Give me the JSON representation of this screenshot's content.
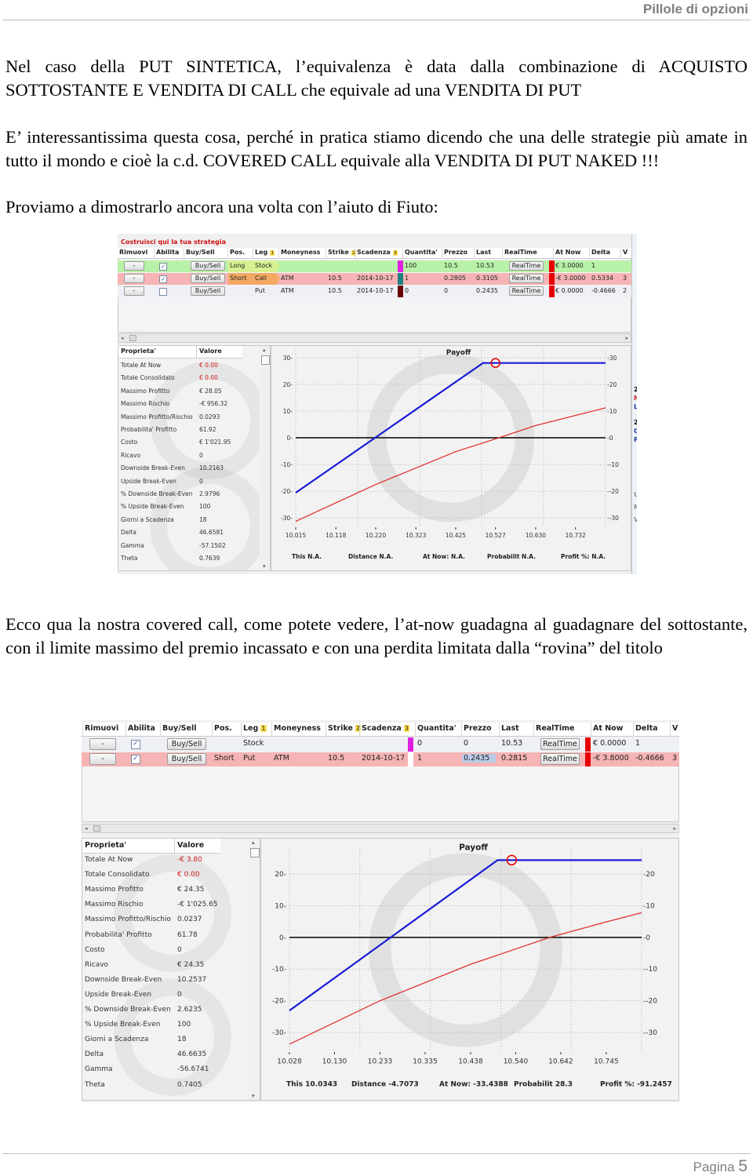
{
  "header": {
    "title": "Pillole di opzioni"
  },
  "paragraphs": [
    "Nel caso della PUT SINTETICA, l’equivalenza è data dalla combinazione di ACQUISTO SOTTOSTANTE E VENDITA DI CALL che equivale ad una VENDITA DI PUT",
    "E’ interessantissima questa cosa, perché in pratica stiamo dicendo che una delle strategie più amate in tutto il mondo e cioè la c.d. COVERED CALL equivale alla VENDITA DI PUT NAKED !!!",
    "Proviamo a dimostrarlo ancora una volta con l’aiuto di Fiuto:",
    "Ecco qua la nostra covered call, come potete vedere, l’at-now guadagna al guadagnare del sottostante, con il limite massimo del premio incassato e con una perdita limitata dalla “rovina” del titolo"
  ],
  "footer": {
    "label": "Pagina",
    "page": "5"
  },
  "colors": {
    "blue_line": "#1a1ad8",
    "red_line": "#e03030",
    "row_long": "#b8f2a8",
    "row_short": "#f6b4b4",
    "row_off": "#eef0f6",
    "status_red": "#e80000",
    "negative": "#d02020"
  },
  "screenshots": [
    {
      "builder_title": "Costruisci qui la tua strategia",
      "columns": [
        "Rimuovi",
        "Abilita",
        "Buy/Sell",
        "Pos.",
        "Leg",
        "Moneyness",
        "Strike",
        "Scadenza",
        "",
        "Quantita'",
        "Prezzo",
        "Last",
        "RealTime",
        "",
        "At Now",
        "Delta",
        "V"
      ],
      "sort_badges": {
        "Leg": "1",
        "Strike": "2",
        "Scadenza": "3"
      },
      "remove_label": "-",
      "buysell_label": "Buy/Sell",
      "realtime_label": "RealTime",
      "rows": [
        {
          "type": "long",
          "checked": true,
          "pos": "Long",
          "leg": "Stock",
          "moneyness": "",
          "strike": "",
          "scadenza": "",
          "leg_color": "#e020e0",
          "quantita": "100",
          "prezzo": "10.5",
          "last": "10.53",
          "at_now": "€ 3.0000",
          "delta": "1",
          "v": "",
          "highlight": "#f0f080"
        },
        {
          "type": "short",
          "checked": true,
          "pos": "Short",
          "leg": "Call",
          "moneyness": "ATM",
          "strike": "10.5",
          "scadenza": "2014-10-17",
          "leg_color": "#1f8080",
          "quantita": "1",
          "prezzo": "0.2805",
          "last": "0.3105",
          "at_now": "-€ 3.0000",
          "delta": "0.5334",
          "v": "3",
          "highlight": "#f0a020"
        },
        {
          "type": "off",
          "checked": false,
          "pos": "",
          "leg": "Put",
          "moneyness": "ATM",
          "strike": "10.5",
          "scadenza": "2014-10-17",
          "leg_color": "#6a0000",
          "quantita": "0",
          "prezzo": "0",
          "last": "0.2435",
          "at_now": "€ 0.0000",
          "delta": "-0.4666",
          "v": "2",
          "highlight": ""
        }
      ],
      "properties_header": [
        "Proprieta'",
        "Valore"
      ],
      "properties": [
        [
          "Totale At Now",
          "€ 0.00",
          true
        ],
        [
          "Totale Consolidato",
          "€ 0.00",
          true
        ],
        [
          "Massimo Profitto",
          "€ 28.05",
          false
        ],
        [
          "Massimo Rischio",
          "-€ 956.32",
          false
        ],
        [
          "Massimo Profitto/Rischio",
          "0.0293",
          false
        ],
        [
          "Probabilita' Profitto",
          "61.92",
          false
        ],
        [
          "Costo",
          "€ 1'021.95",
          false
        ],
        [
          "Ricavo",
          "0",
          false
        ],
        [
          "Downside Break-Even",
          "10.2163",
          false
        ],
        [
          "Upside Break-Even",
          "0",
          false
        ],
        [
          "% Downside Break-Even",
          "2.9796",
          false
        ],
        [
          "% Upside Break-Even",
          "100",
          false
        ],
        [
          "Giorni a Scadenza",
          "18",
          false
        ],
        [
          "Delta",
          "46.6581",
          false
        ],
        [
          "Gamma",
          "-57.1502",
          false
        ],
        [
          "Theta",
          "0.7639",
          false
        ]
      ],
      "side_fragments": [
        "20",
        "No",
        "Le",
        "20",
        "Gi",
        "Pl",
        "U",
        "M",
        "V"
      ],
      "chart_data": {
        "type": "line",
        "title": "Payoff",
        "x_ticks": [
          "10.015",
          "10.118",
          "10.220",
          "10.323",
          "10.425",
          "10.527",
          "10.630",
          "10.732"
        ],
        "y_ticks": [
          -30,
          -20,
          -10,
          0,
          10,
          20,
          30
        ],
        "xlim": [
          10.015,
          10.809
        ],
        "ylim": [
          -33.2,
          32.9
        ],
        "grid": true,
        "series": [
          {
            "color": "#1a1ad8",
            "points": [
              [
                10.015,
                -20.6
              ],
              [
                10.495,
                28.0
              ],
              [
                10.809,
                28.0
              ]
            ]
          },
          {
            "color": "#e03030",
            "points": [
              [
                10.015,
                -31.3
              ],
              [
                10.22,
                -17.5
              ],
              [
                10.425,
                -5.2
              ],
              [
                10.536,
                0
              ],
              [
                10.63,
                4.6
              ],
              [
                10.809,
                11.2
              ]
            ]
          }
        ],
        "marker": [
          10.527,
          28.0
        ],
        "stats": [
          [
            "This",
            "N.A."
          ],
          [
            "Distance",
            "N.A."
          ],
          [
            "At Now:",
            "N.A."
          ],
          [
            "Probabilit",
            "N.A."
          ],
          [
            "Profit %:",
            "N.A."
          ]
        ]
      }
    },
    {
      "builder_title": "",
      "columns": [
        "Rimuovi",
        "Abilita",
        "Buy/Sell",
        "Pos.",
        "Leg",
        "Moneyness",
        "Strike",
        "Scadenza",
        "",
        "Quantita'",
        "Prezzo",
        "Last",
        "RealTime",
        "",
        "At Now",
        "Delta",
        "V"
      ],
      "sort_badges": {
        "Leg": "1",
        "Strike": "2",
        "Scadenza": "3"
      },
      "remove_label": "-",
      "buysell_label": "Buy/Sell",
      "realtime_label": "RealTime",
      "rows": [
        {
          "type": "off",
          "checked": true,
          "pos": "",
          "leg": "Stock",
          "moneyness": "",
          "strike": "",
          "scadenza": "",
          "leg_color": "#e020e0",
          "quantita": "0",
          "prezzo": "0",
          "last": "10.53",
          "at_now": "€ 0.0000",
          "delta": "1",
          "v": "",
          "highlight": ""
        },
        {
          "type": "short",
          "checked": true,
          "pos": "Short",
          "leg": "Put",
          "moneyness": "ATM",
          "strike": "10.5",
          "scadenza": "2014-10-17",
          "leg_color": "#ffffff",
          "quantita": "1",
          "prezzo": "0.2435",
          "last": "0.2815",
          "at_now": "-€ 3.8000",
          "delta": "-0.4666",
          "v": "3",
          "highlight": ""
        }
      ],
      "properties_header": [
        "Proprieta'",
        "Valore"
      ],
      "properties": [
        [
          "Totale At Now",
          "-€ 3.80",
          true
        ],
        [
          "Totale Consolidato",
          "€ 0.00",
          true
        ],
        [
          "Massimo Profitto",
          "€ 24.35",
          false
        ],
        [
          "Massimo Rischio",
          "-€ 1'025.65",
          false
        ],
        [
          "Massimo Profitto/Rischio",
          "0.0237",
          false
        ],
        [
          "Probabilita' Profitto",
          "61.78",
          false
        ],
        [
          "Costo",
          "0",
          false
        ],
        [
          "Ricavo",
          "€ 24.35",
          false
        ],
        [
          "Downside Break-Even",
          "10.2537",
          false
        ],
        [
          "Upside Break-Even",
          "0",
          false
        ],
        [
          "% Downside Break-Even",
          "2.6235",
          false
        ],
        [
          "% Upside Break-Even",
          "100",
          false
        ],
        [
          "Giorni a Scadenza",
          "18",
          false
        ],
        [
          "Delta",
          "46.6635",
          false
        ],
        [
          "Gamma",
          "-56.6741",
          false
        ],
        [
          "Theta",
          "0.7405",
          false
        ]
      ],
      "side_fragments": [],
      "chart_data": {
        "type": "line",
        "title": "Payoff",
        "x_ticks": [
          "10.028",
          "10.130",
          "10.233",
          "10.335",
          "10.438",
          "10.540",
          "10.642",
          "10.745"
        ],
        "y_ticks": [
          -30,
          -20,
          -10,
          0,
          10,
          20
        ],
        "xlim": [
          10.028,
          10.825
        ],
        "ylim": [
          -36.2,
          28.2
        ],
        "grid": true,
        "series": [
          {
            "color": "#1a1ad8",
            "points": [
              [
                10.028,
                -23.1
              ],
              [
                10.499,
                24.4
              ],
              [
                10.825,
                24.4
              ]
            ]
          },
          {
            "color": "#e03030",
            "points": [
              [
                10.028,
                -33.7
              ],
              [
                10.233,
                -20.0
              ],
              [
                10.438,
                -8.5
              ],
              [
                10.617,
                0
              ],
              [
                10.745,
                4.9
              ],
              [
                10.825,
                7.8
              ]
            ]
          }
        ],
        "marker": [
          10.531,
          24.4
        ],
        "stats": [
          [
            "This",
            "10.0343"
          ],
          [
            "Distance",
            "-4.7073"
          ],
          [
            "At Now:",
            "-33.4388"
          ],
          [
            "Probabilit",
            "28.3"
          ],
          [
            "Profit %:",
            "-91.2457"
          ]
        ]
      }
    }
  ]
}
